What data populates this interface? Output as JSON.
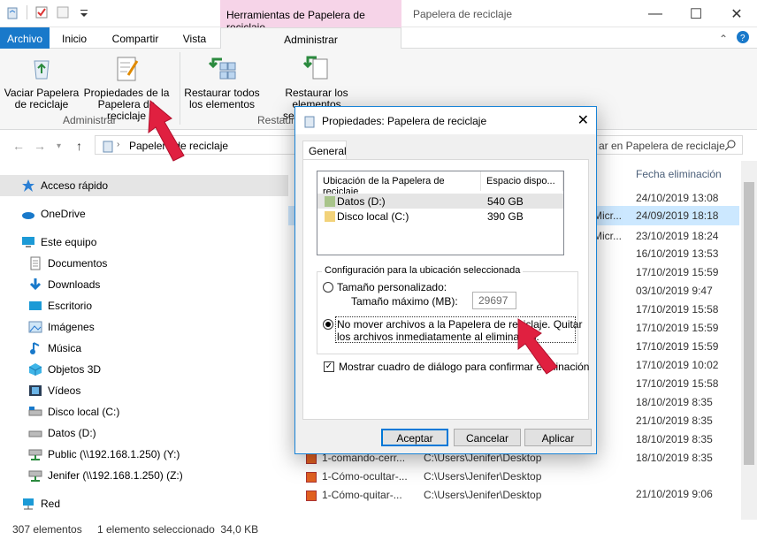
{
  "window": {
    "title": "Papelera de reciclaje",
    "context_tab_title": "Herramientas de Papelera de reciclaje"
  },
  "ribbon_tabs": [
    "Archivo",
    "Inicio",
    "Compartir",
    "Vista",
    "Administrar"
  ],
  "ribbon": {
    "empty_bin": "Vaciar Papelera de reciclaje",
    "properties": "Propiedades de la Papelera de reciclaje",
    "restore_all": "Restaurar todos los elementos",
    "restore_selected": "Restaurar los elementos seleccionados",
    "group_admin": "Administrar",
    "group_restore": "Restaura"
  },
  "address": {
    "path": "Papelera de reciclaje",
    "search_placeholder": "ar en Papelera de reciclaje"
  },
  "nav_pane": [
    {
      "label": "Acceso rápido",
      "icon": "star-icon"
    },
    {
      "label": "OneDrive",
      "icon": "cloud-icon"
    },
    {
      "label": "Este equipo",
      "icon": "computer-icon"
    },
    {
      "label": "Documentos",
      "icon": "documents-icon"
    },
    {
      "label": "Downloads",
      "icon": "download-icon"
    },
    {
      "label": "Escritorio",
      "icon": "desktop-icon"
    },
    {
      "label": "Imágenes",
      "icon": "pictures-icon"
    },
    {
      "label": "Música",
      "icon": "music-icon"
    },
    {
      "label": "Objetos 3D",
      "icon": "cube-icon"
    },
    {
      "label": "Vídeos",
      "icon": "video-icon"
    },
    {
      "label": "Disco local (C:)",
      "icon": "drive-icon"
    },
    {
      "label": "Datos (D:)",
      "icon": "drive-icon"
    },
    {
      "label": "Public (\\\\192.168.1.250) (Y:)",
      "icon": "network-drive-icon"
    },
    {
      "label": "Jenifer (\\\\192.168.1.250) (Z:)",
      "icon": "network-drive-icon"
    },
    {
      "label": "Red",
      "icon": "network-icon"
    }
  ],
  "files": {
    "column_date": "Fecha eliminación",
    "dates": [
      "24/10/2019 13:08",
      "24/09/2019 18:18",
      "23/10/2019 18:24",
      "16/10/2019 13:53",
      "17/10/2019 15:59",
      "03/10/2019 9:47",
      "17/10/2019 15:58",
      "17/10/2019 15:59",
      "17/10/2019 15:59",
      "17/10/2019 10:02",
      "17/10/2019 15:58",
      "18/10/2019 8:35",
      "21/10/2019 8:35",
      "18/10/2019 8:35",
      "18/10/2019 8:35",
      "21/10/2019 9:06"
    ],
    "partial_origin": [
      "Micr...",
      "Micr..."
    ],
    "visible_rows": [
      {
        "name": "1-comando-cerr...",
        "origin": "C:\\Users\\Jenifer\\Desktop"
      },
      {
        "name": "1-Cómo-ocultar-...",
        "origin": "C:\\Users\\Jenifer\\Desktop"
      },
      {
        "name": "1-Cómo-quitar-...",
        "origin": "C:\\Users\\Jenifer\\Desktop"
      }
    ]
  },
  "status": {
    "count": "307 elementos",
    "selection": "1 elemento seleccionado  34,0 KB"
  },
  "dialog": {
    "title": "Propiedades: Papelera de reciclaje",
    "tab": "General",
    "col_location": "Ubicación de la Papelera de reciclaje",
    "col_space": "Espacio dispo...",
    "locations": [
      {
        "name": "Datos (D:)",
        "space": "540 GB"
      },
      {
        "name": "Disco local (C:)",
        "space": "390 GB"
      }
    ],
    "group_title": "Configuración para la ubicación seleccionada",
    "custom_size": "Tamaño personalizado:",
    "max_size_label": "Tamaño máximo (MB):",
    "max_size_value": "29697",
    "no_move_line1": "No mover archivos a la Papelera de reciclaje. Quitar",
    "no_move_line2": "los archivos inmediatamente al eliminarlos.",
    "confirm_dialog": "Mostrar cuadro de diálogo para confirmar eliminación",
    "ok": "Aceptar",
    "cancel": "Cancelar",
    "apply": "Aplicar"
  },
  "colors": {
    "accent": "#1979ca",
    "context_tab": "#f6d4e8",
    "arrow": "#e02040"
  }
}
